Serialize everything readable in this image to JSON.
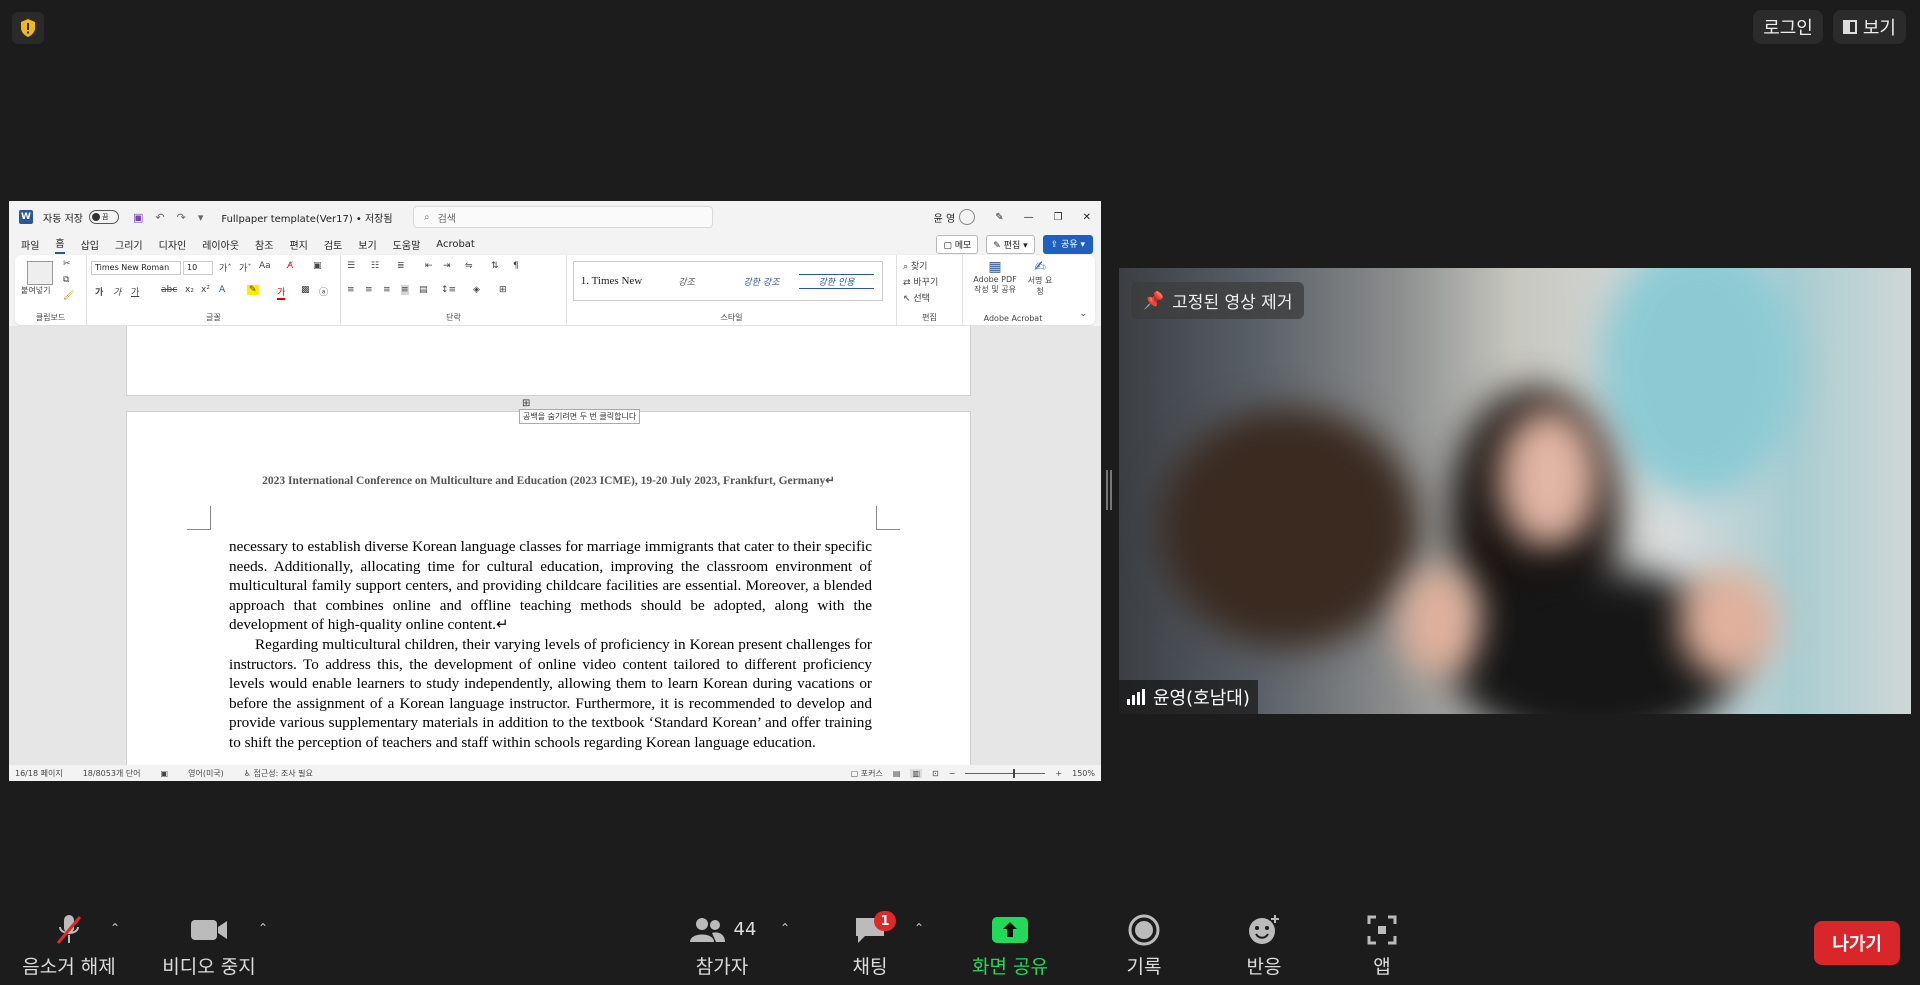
{
  "top": {
    "login_label": "로그인",
    "view_label": "보기"
  },
  "word": {
    "autosave_label": "자동 저장",
    "autosave_state": "끔",
    "doc_title": "Fullpaper template(Ver17) • 저장됨",
    "search_placeholder": "검색",
    "user_name": "윤 영",
    "menu": [
      "파일",
      "홈",
      "삽입",
      "그리기",
      "디자인",
      "레이아웃",
      "참조",
      "편지",
      "검토",
      "보기",
      "도움말",
      "Acrobat"
    ],
    "memo_label": "메모",
    "edit_label": "편집",
    "share_label": "공유",
    "ribbon": {
      "paste_label": "붙여넣기",
      "clipboard_group": "클립보드",
      "font_name": "Times New Roman",
      "font_size": "10",
      "font_group": "글꼴",
      "paragraph_group": "단락",
      "styles": [
        "1. Times New",
        "강조",
        "강한 강조",
        "강한 인용"
      ],
      "styles_group": "스타일",
      "find_label": "찾기",
      "replace_label": "바꾸기",
      "select_label": "선택",
      "edit_group": "편집",
      "acrobat_create": "Adobe PDF 작성 및 공유",
      "acrobat_sign": "서명 요청",
      "acrobat_group": "Adobe Acrobat"
    },
    "hint": "공백을 숨기려면 두 번 클릭합니다",
    "header_text": "2023 International Conference on Multiculture and Education (2023 ICME), 19-20 July 2023, Frankfurt, Germany↵",
    "paragraphs": [
      "necessary to establish diverse Korean language classes for marriage immigrants that cater to their specific needs. Additionally, allocating time for cultural education, improving the classroom environment of multicultural family support centers, and providing childcare facilities are essential. Moreover, a blended approach that combines online and offline teaching methods should be adopted, along with the development of high-quality online content.↵",
      "Regarding multicultural children, their varying levels of proficiency in Korean present challenges for instructors. To address this, the development of online video content tailored to different proficiency levels would enable learners to study independently, allowing them to learn Korean during vacations or before the assignment of a Korean language instructor. Furthermore, it is recommended to develop and provide various supplementary materials in addition to the textbook ‘Standard Korean’ and offer training to shift the perception of teachers and staff within schools regarding Korean language education."
    ],
    "status": {
      "page": "16/18 페이지",
      "words": "18/8053개 단어",
      "language": "영어(미국)",
      "accessibility": "접근성: 조사 필요",
      "focus": "포커스",
      "zoom": "150%"
    }
  },
  "video": {
    "unpin_label": "고정된 영상 제거",
    "participant_name": "윤영(호남대)"
  },
  "toolbar": {
    "mute_label": "음소거 해제",
    "video_label": "비디오 중지",
    "participants_label": "참가자",
    "participants_count": "44",
    "chat_label": "채팅",
    "chat_badge": "1",
    "share_label": "화면 공유",
    "record_label": "기록",
    "react_label": "반응",
    "apps_label": "앱",
    "leave_label": "나가기",
    "share_color": "#23d959",
    "leave_color": "#d8262a"
  }
}
